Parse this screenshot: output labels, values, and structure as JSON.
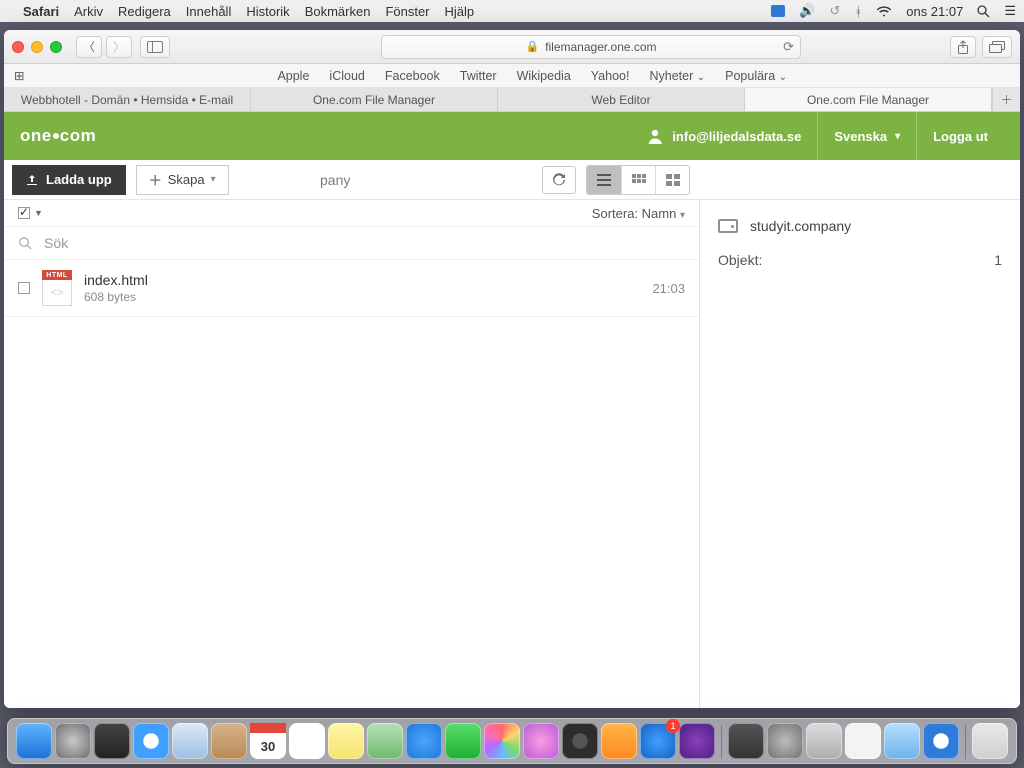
{
  "mac_menu": {
    "app": "Safari",
    "items": [
      "Arkiv",
      "Redigera",
      "Innehåll",
      "Historik",
      "Bokmärken",
      "Fönster",
      "Hjälp"
    ],
    "clock": "ons 21:07"
  },
  "safari": {
    "url_host": "filemanager.one.com",
    "favorites": [
      "Apple",
      "iCloud",
      "Facebook",
      "Twitter",
      "Wikipedia",
      "Yahoo!",
      "Nyheter",
      "Populära"
    ],
    "tabs": [
      "Webbhotell  -  Domän • Hemsida • E-mail",
      "One.com File Manager",
      "Web Editor",
      "One.com File Manager"
    ],
    "active_tab_index": 3
  },
  "onecom": {
    "logo_text": "one.com",
    "user_email": "info@liljedalsdata.se",
    "language": "Svenska",
    "logout": "Logga ut"
  },
  "toolbar": {
    "upload_label": "Ladda upp",
    "create_label": "Skapa",
    "crumb_fragment": "pany"
  },
  "list": {
    "select_all_checked": true,
    "sort_prefix": "Sortera: ",
    "sort_field": "Namn",
    "search_placeholder": "Sök",
    "files": [
      {
        "name": "index.html",
        "size": "608 bytes",
        "time": "21:03",
        "badge": "HTML"
      }
    ]
  },
  "sidebar": {
    "drive_label": "studyit.company",
    "object_key": "Objekt:",
    "object_val": "1"
  }
}
